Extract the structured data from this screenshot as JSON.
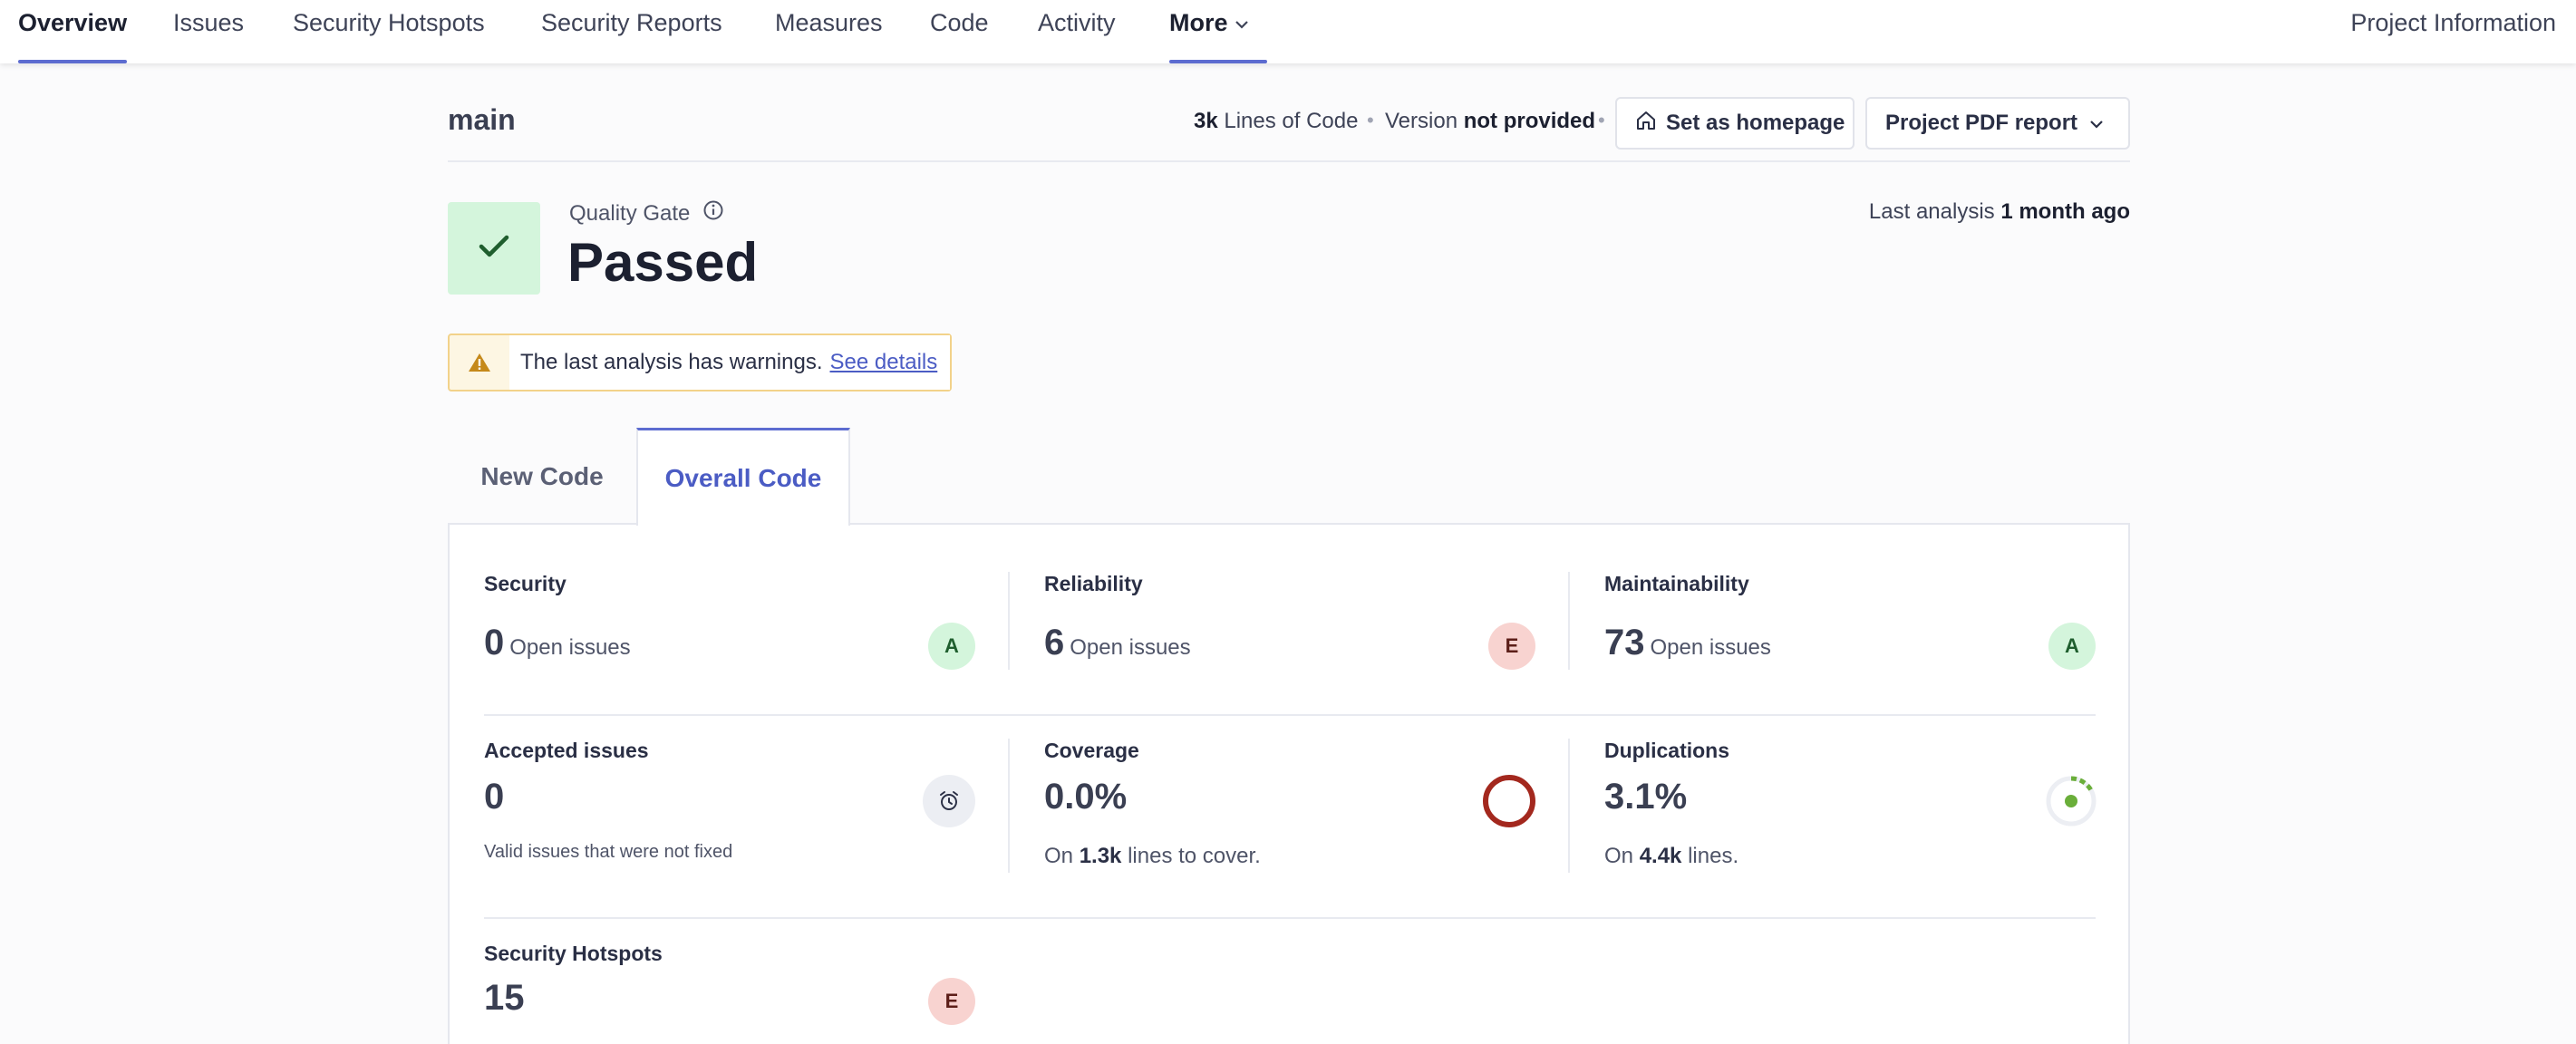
{
  "nav": {
    "items": [
      "Overview",
      "Issues",
      "Security Hotspots",
      "Security Reports",
      "Measures",
      "Code",
      "Activity",
      "More"
    ],
    "project_info": "Project Information"
  },
  "header": {
    "branch": "main",
    "loc_value": "3k",
    "loc_label": "Lines of Code",
    "version_label": "Version",
    "version_value": "not provided",
    "homepage_button": "Set as homepage",
    "pdf_button": "Project PDF report"
  },
  "quality_gate": {
    "label": "Quality Gate",
    "status": "Passed",
    "last_analysis_label": "Last analysis",
    "last_analysis_value": "1 month ago"
  },
  "warning": {
    "text": "The last analysis has warnings.",
    "link": "See details"
  },
  "tabs": [
    "New Code",
    "Overall Code"
  ],
  "metrics": {
    "security": {
      "title": "Security",
      "value": "0",
      "sub": "Open issues",
      "rating": "A"
    },
    "reliability": {
      "title": "Reliability",
      "value": "6",
      "sub": "Open issues",
      "rating": "E"
    },
    "maintainability": {
      "title": "Maintainability",
      "value": "73",
      "sub": "Open issues",
      "rating": "A"
    },
    "accepted": {
      "title": "Accepted issues",
      "value": "0",
      "note": "Valid issues that were not fixed"
    },
    "coverage": {
      "title": "Coverage",
      "value": "0.0%",
      "note_prefix": "On",
      "note_value": "1.3k",
      "note_suffix": "lines to cover.",
      "percent": 0.0
    },
    "duplications": {
      "title": "Duplications",
      "value": "3.1%",
      "note_prefix": "On",
      "note_value": "4.4k",
      "note_suffix": "lines.",
      "percent": 3.1
    },
    "hotspots": {
      "title": "Security Hotspots",
      "value": "15",
      "rating": "E"
    }
  },
  "colors": {
    "accent": "#5d6cd0",
    "passed_bg": "#d4f5dc",
    "rating_a": "#d4f5dc",
    "rating_e": "#f8d3d0",
    "coverage_ring": "#a3281e",
    "duplication": "#6aae3a"
  }
}
